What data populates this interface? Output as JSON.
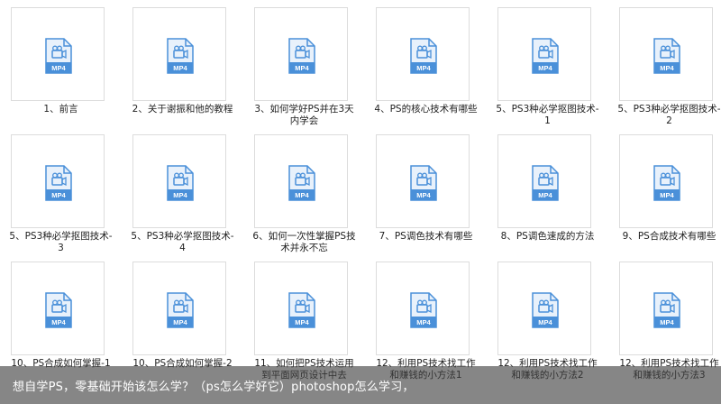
{
  "files": [
    {
      "name": "1、前言",
      "icon": "mp4-file-icon",
      "type_label": "MP4"
    },
    {
      "name": "2、关于谢振和他的教程",
      "icon": "mp4-file-icon",
      "type_label": "MP4"
    },
    {
      "name": "3、如何学好PS并在3天内学会",
      "icon": "mp4-file-icon",
      "type_label": "MP4"
    },
    {
      "name": "4、PS的核心技术有哪些",
      "icon": "mp4-file-icon",
      "type_label": "MP4"
    },
    {
      "name": "5、PS3种必学抠图技术-1",
      "icon": "mp4-file-icon",
      "type_label": "MP4"
    },
    {
      "name": "5、PS3种必学抠图技术-2",
      "icon": "mp4-file-icon",
      "type_label": "MP4"
    },
    {
      "name": "5、PS3种必学抠图技术-3",
      "icon": "mp4-file-icon",
      "type_label": "MP4"
    },
    {
      "name": "5、PS3种必学抠图技术-4",
      "icon": "mp4-file-icon",
      "type_label": "MP4"
    },
    {
      "name": "6、如何一次性掌握PS技术并永不忘",
      "icon": "mp4-file-icon",
      "type_label": "MP4"
    },
    {
      "name": "7、PS调色技术有哪些",
      "icon": "mp4-file-icon",
      "type_label": "MP4"
    },
    {
      "name": "8、PS调色速成的方法",
      "icon": "mp4-file-icon",
      "type_label": "MP4"
    },
    {
      "name": "9、PS合成技术有哪些",
      "icon": "mp4-file-icon",
      "type_label": "MP4"
    },
    {
      "name": "10、PS合成如何掌握-1",
      "icon": "mp4-file-icon",
      "type_label": "MP4"
    },
    {
      "name": "10、PS合成如何掌握-2",
      "icon": "mp4-file-icon",
      "type_label": "MP4"
    },
    {
      "name": "11、如何把PS技术运用到平面网页设计中去",
      "icon": "mp4-file-icon",
      "type_label": "MP4"
    },
    {
      "name": "12、利用PS技术找工作和赚钱的小方法1",
      "icon": "mp4-file-icon",
      "type_label": "MP4"
    },
    {
      "name": "12、利用PS技术找工作和赚钱的小方法2",
      "icon": "mp4-file-icon",
      "type_label": "MP4"
    },
    {
      "name": "12、利用PS技术找工作和赚钱的小方法3",
      "icon": "mp4-file-icon",
      "type_label": "MP4"
    }
  ],
  "caption": "想自学PS，零基础开始该怎么学？（ps怎么学好它）photoshop怎么学习，",
  "colors": {
    "icon_blue": "#4a90d9",
    "icon_light": "#e8f1fb",
    "thumb_border": "#dcdcdc",
    "caption_bg": "#3c3c3c"
  }
}
